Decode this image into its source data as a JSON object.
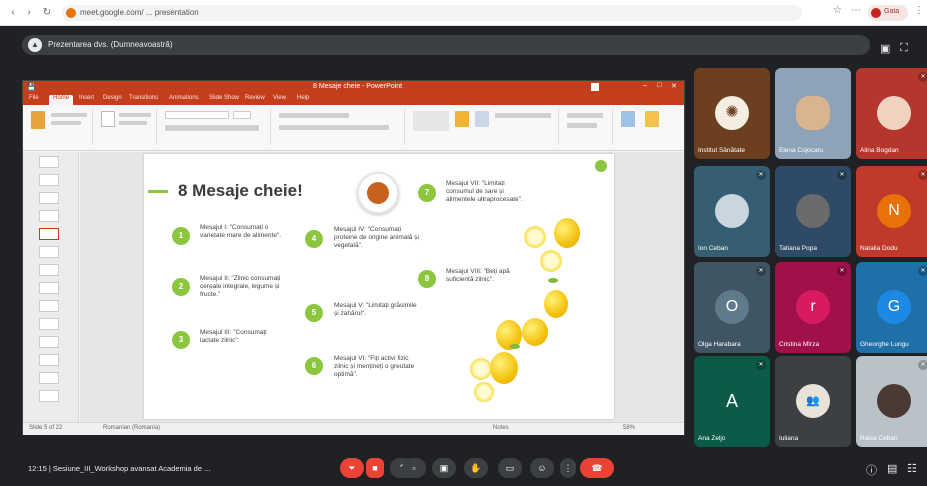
{
  "browser": {
    "url": "meet.google.com/ ... presentation",
    "profile_label": "Gata"
  },
  "meet": {
    "presenter_label": "Prezentarea dvs. (Dumneavoastră)",
    "meeting_info": "12:15 | Sesiune_III_Workshop avansat Academia de ..."
  },
  "ppt": {
    "title": "8 Mesaje cheie - PowerPoint",
    "tabs": [
      "File",
      "Home",
      "Insert",
      "Design",
      "Transitions",
      "Animations",
      "Slide Show",
      "Review",
      "View",
      "Help"
    ],
    "status": [
      "Slide 5 of 22",
      "Romanian (Romania)",
      "Notes",
      "58%"
    ]
  },
  "slide": {
    "title": "8 Mesaje cheie!",
    "items": [
      {
        "num": "1",
        "text": "Mesajul I: \"Consumați o varietate mare de alimente\"."
      },
      {
        "num": "2",
        "text": "Mesajul II: \"Zilnic consumați cereale integrale, legume și fructe.\""
      },
      {
        "num": "3",
        "text": "Mesajul III: \"Consumați lactate zilnic\"."
      },
      {
        "num": "4",
        "text": "Mesajul IV: \"Consumați proteine de origine animală și vegetală\"."
      },
      {
        "num": "5",
        "text": "Mesajul V: \"Limitați grăsimile și zahărul\"."
      },
      {
        "num": "6",
        "text": "Mesajul VI: \"Fiți activi fizic zilnic și mențineți o greutate optimă\"."
      },
      {
        "num": "7",
        "text": "Mesajul VII: \"Limitați consumul de sare și alimentele ultraprocesate\"."
      },
      {
        "num": "8",
        "text": "Mesajul VIII: \"Beți apă suficientă zilnic\"."
      }
    ]
  },
  "participants": [
    {
      "name": "Institut Sănătate",
      "color": "#6b3f1f",
      "initial": "",
      "kind": "logo"
    },
    {
      "name": "Elena Cojocaru",
      "color": "#8fa3b8",
      "initial": "",
      "kind": "photo"
    },
    {
      "name": "Alina Bogdan",
      "color": "#b5362c",
      "initial": "",
      "kind": "photo"
    },
    {
      "name": "Ion Ceban",
      "color": "#355e73",
      "initial": "",
      "kind": "photo"
    },
    {
      "name": "Tatiana Popa",
      "color": "#2f4a66",
      "initial": "",
      "kind": "photo"
    },
    {
      "name": "Natalia Dodu",
      "color": "#c0392b",
      "initial": "N",
      "kind": "letter"
    },
    {
      "name": "Olga Harabara",
      "color": "#3f5564",
      "initial": "O",
      "kind": "letter"
    },
    {
      "name": "Cristina Mîrza",
      "color": "#a0104a",
      "initial": "r",
      "kind": "letter"
    },
    {
      "name": "Gheorghe Lungu",
      "color": "#1f6fa8",
      "initial": "G",
      "kind": "letter"
    },
    {
      "name": "Ana Zeljo",
      "color": "#0c5b48",
      "initial": "A",
      "kind": "letter"
    },
    {
      "name": "Iuliana",
      "color": "#3c4043",
      "initial": "",
      "kind": "group"
    },
    {
      "name": "Raisa Ceban",
      "color": "#b9c2c9",
      "initial": "",
      "kind": "photo"
    }
  ],
  "icons": {
    "back": "←",
    "forward": "→",
    "reload": "↻",
    "mic": "🎤",
    "cam": "■",
    "cc": "CC",
    "hand": "✋",
    "present": "▭",
    "more": "⋮",
    "end": "✆"
  }
}
